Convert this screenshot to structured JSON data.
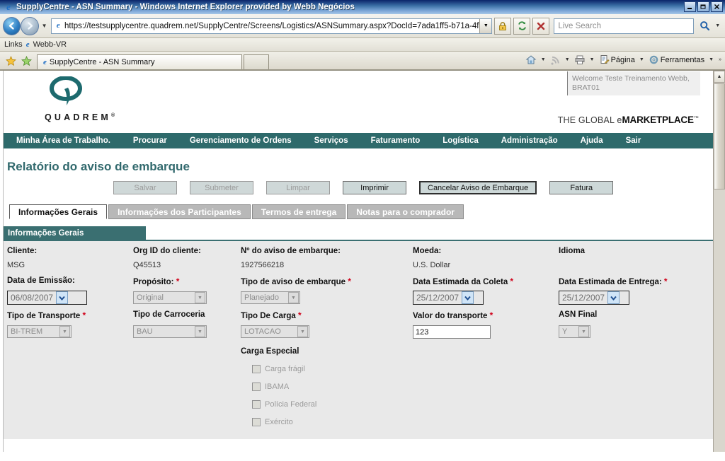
{
  "window": {
    "title": "SupplyCentre - ASN Summary - Windows Internet Explorer provided by Webb Negócios",
    "minimize_label": "Minimize",
    "restore_label": "Restore",
    "close_label": "Close"
  },
  "browser": {
    "back_label": "Back",
    "forward_label": "Forward",
    "history_dropdown_label": "Recent Pages",
    "address": "https://testsupplycentre.quadrem.net/SupplyCentre/Screens/Logistics/ASNSummary.aspx?DocId=7ada1ff5-b71a-4fae-",
    "address_caret_label": "Address dropdown",
    "refresh_label": "Refresh",
    "stop_label": "Stop",
    "security_label": "Security lock",
    "search_placeholder": "Live Search",
    "search_go_label": "Search",
    "search_dropdown_label": "Search provider",
    "links_label": "Links",
    "links_items": [
      "Webb-VR"
    ],
    "tab_title": "SupplyCentre - ASN Summary",
    "new_tab_label": "New Tab",
    "favorites_add_label": "Add to Favorites",
    "favorites_center_label": "Favorites Center",
    "commands": [
      {
        "label": "",
        "icon": "home-icon",
        "caret": true
      },
      {
        "label": "",
        "icon": "rss-icon",
        "caret": true
      },
      {
        "label": "",
        "icon": "print-icon",
        "caret": true
      },
      {
        "label": "Página",
        "icon": "page-icon",
        "caret": true
      },
      {
        "label": "Ferramentas",
        "icon": "tools-icon",
        "caret": true
      }
    ],
    "overflow_label": "»"
  },
  "site": {
    "logo_word": "QUADREM",
    "logo_reg": "®",
    "welcome": "Welcome  Teste Treinamento Webb, BRAT01",
    "tagline_pre": "THE GLOBAL e",
    "tagline_bold": "MARKETPLACE",
    "tagline_tm": "™",
    "nav": [
      "Minha Área de Trabalho.",
      "Procurar",
      "Gerenciamento de Ordens",
      "Serviços",
      "Faturamento",
      "Logística",
      "Administração",
      "Ajuda",
      "Sair"
    ]
  },
  "page": {
    "title": "Relatório do aviso de embarque",
    "buttons": [
      {
        "label": "Salvar",
        "state": "disabled"
      },
      {
        "label": "Submeter",
        "state": "disabled"
      },
      {
        "label": "Limpar",
        "state": "disabled"
      },
      {
        "label": "Imprimir",
        "state": "enabled"
      },
      {
        "label": "Cancelar Aviso de Embarque",
        "state": "focused"
      },
      {
        "label": "Fatura",
        "state": "enabled"
      }
    ],
    "tabs": [
      {
        "label": "Informações Gerais",
        "active": true
      },
      {
        "label": "Informações dos Participantes",
        "active": false
      },
      {
        "label": "Termos de entrega",
        "active": false
      },
      {
        "label": "Notas para o comprador",
        "active": false
      }
    ],
    "section_title": "Informações Gerais"
  },
  "form": {
    "cliente": {
      "label": "Cliente:",
      "value": "MSG"
    },
    "org_id": {
      "label": "Org ID do cliente:",
      "value": "Q45513"
    },
    "asn_num": {
      "label": "Nº do aviso de embarque:",
      "value": "1927566218"
    },
    "moeda": {
      "label": "Moeda:",
      "value": "U.S. Dollar"
    },
    "idioma": {
      "label": "Idioma",
      "value": ""
    },
    "data_emissao": {
      "label": "Data de Emissão:",
      "value": "06/08/2007"
    },
    "proposito": {
      "label": "Propósito:",
      "required": "*",
      "value": "Original"
    },
    "tipo_aviso": {
      "label": "Tipo de aviso de embarque",
      "required": "*",
      "value": "Planejado"
    },
    "data_coleta": {
      "label": "Data Estimada da Coleta",
      "required": "*",
      "value": "25/12/2007"
    },
    "data_entrega": {
      "label": "Data Estimada de Entrega:",
      "required": "*",
      "value": "25/12/2007"
    },
    "tipo_transporte": {
      "label": "Tipo de Transporte",
      "required": "*",
      "value": "BI-TREM"
    },
    "tipo_carroceria": {
      "label": "Tipo de Carroceria",
      "value": "BAU"
    },
    "tipo_carga": {
      "label": "Tipo De Carga",
      "required": "*",
      "value": "LOTACAO"
    },
    "valor_transporte": {
      "label": "Valor do transporte",
      "required": "*",
      "value": "123"
    },
    "asn_final": {
      "label": "ASN Final",
      "value": "Y"
    },
    "carga_especial": {
      "label": "Carga Especial",
      "items": [
        {
          "label": "Carga frágil",
          "checked": false
        },
        {
          "label": "IBAMA",
          "checked": false
        },
        {
          "label": "Polícia Federal",
          "checked": false
        },
        {
          "label": "Exército",
          "checked": false
        }
      ]
    }
  },
  "scrollbar": {
    "up_label": "▲",
    "down_label": "▼"
  },
  "colors": {
    "brand_teal": "#2e6a6b",
    "section_teal": "#3a6f71",
    "title_teal": "#31696d",
    "required_red": "#d0021b",
    "form_bg": "#e9e9e9"
  }
}
